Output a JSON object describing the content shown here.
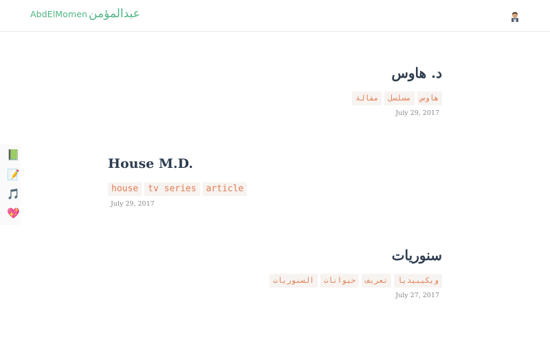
{
  "header": {
    "logo_latin": "AbdElMomen",
    "logo_arabic": "عبدالمؤمن",
    "user_icon": "person-icon"
  },
  "side_menu": {
    "items": [
      {
        "glyph": "📗",
        "icon": "book-icon"
      },
      {
        "glyph": "📝",
        "icon": "memo-icon"
      },
      {
        "glyph": "🎵",
        "icon": "music-note-icon"
      },
      {
        "glyph": "💖",
        "icon": "heart-icon"
      }
    ]
  },
  "posts": [
    {
      "title": "د. هاوس",
      "tags": [
        "هاوس",
        "مسلسل",
        "مقالة"
      ],
      "date": "July 29, 2017"
    },
    {
      "title": "House M.D.",
      "tags": [
        "house",
        "tv series",
        "article"
      ],
      "date": "July 29, 2017"
    },
    {
      "title": "سنوريات",
      "tags": [
        "ويكيبيديا",
        "تعريف",
        "حيوانات",
        "السنوريات"
      ],
      "date": "July 27, 2017"
    }
  ]
}
